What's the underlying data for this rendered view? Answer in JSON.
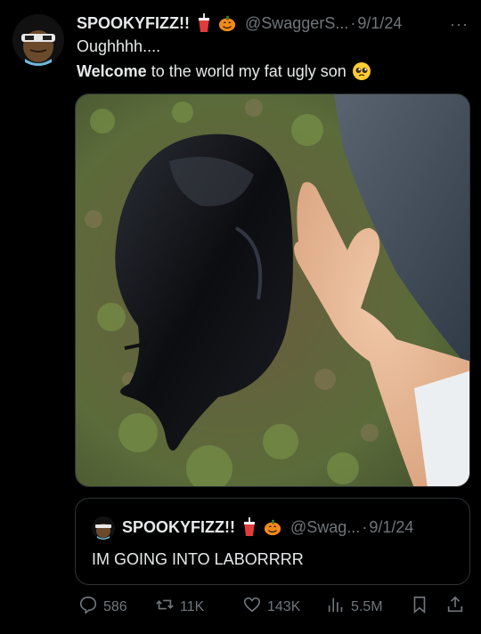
{
  "tweet": {
    "display_name": "SPOOKYFIZZ!!",
    "handle": "@SwaggerS...",
    "separator": "·",
    "date": "9/1/24",
    "more": "···",
    "line1": "Oughhhh....",
    "line2_bold": "Welcome",
    "line2_rest": "to the world my fat ugly son"
  },
  "quote": {
    "display_name": "SPOOKYFIZZ!!",
    "handle": "@Swag...",
    "separator": "·",
    "date": "9/1/24",
    "text": "IM GOING INTO LABORRRR"
  },
  "actions": {
    "replies": "586",
    "reposts": "11K",
    "likes": "143K",
    "views": "5.5M"
  },
  "icons": {
    "cup": "cup-icon",
    "pumpkin": "pumpkin-icon",
    "pleading": "pleading-face-icon",
    "reply": "reply-icon",
    "repost": "repost-icon",
    "like": "heart-icon",
    "views": "views-icon",
    "bookmark": "bookmark-icon",
    "share": "share-icon"
  },
  "colors": {
    "background": "#000000",
    "text": "#e7e9ea",
    "muted": "#71767b",
    "border": "#2f3336"
  }
}
